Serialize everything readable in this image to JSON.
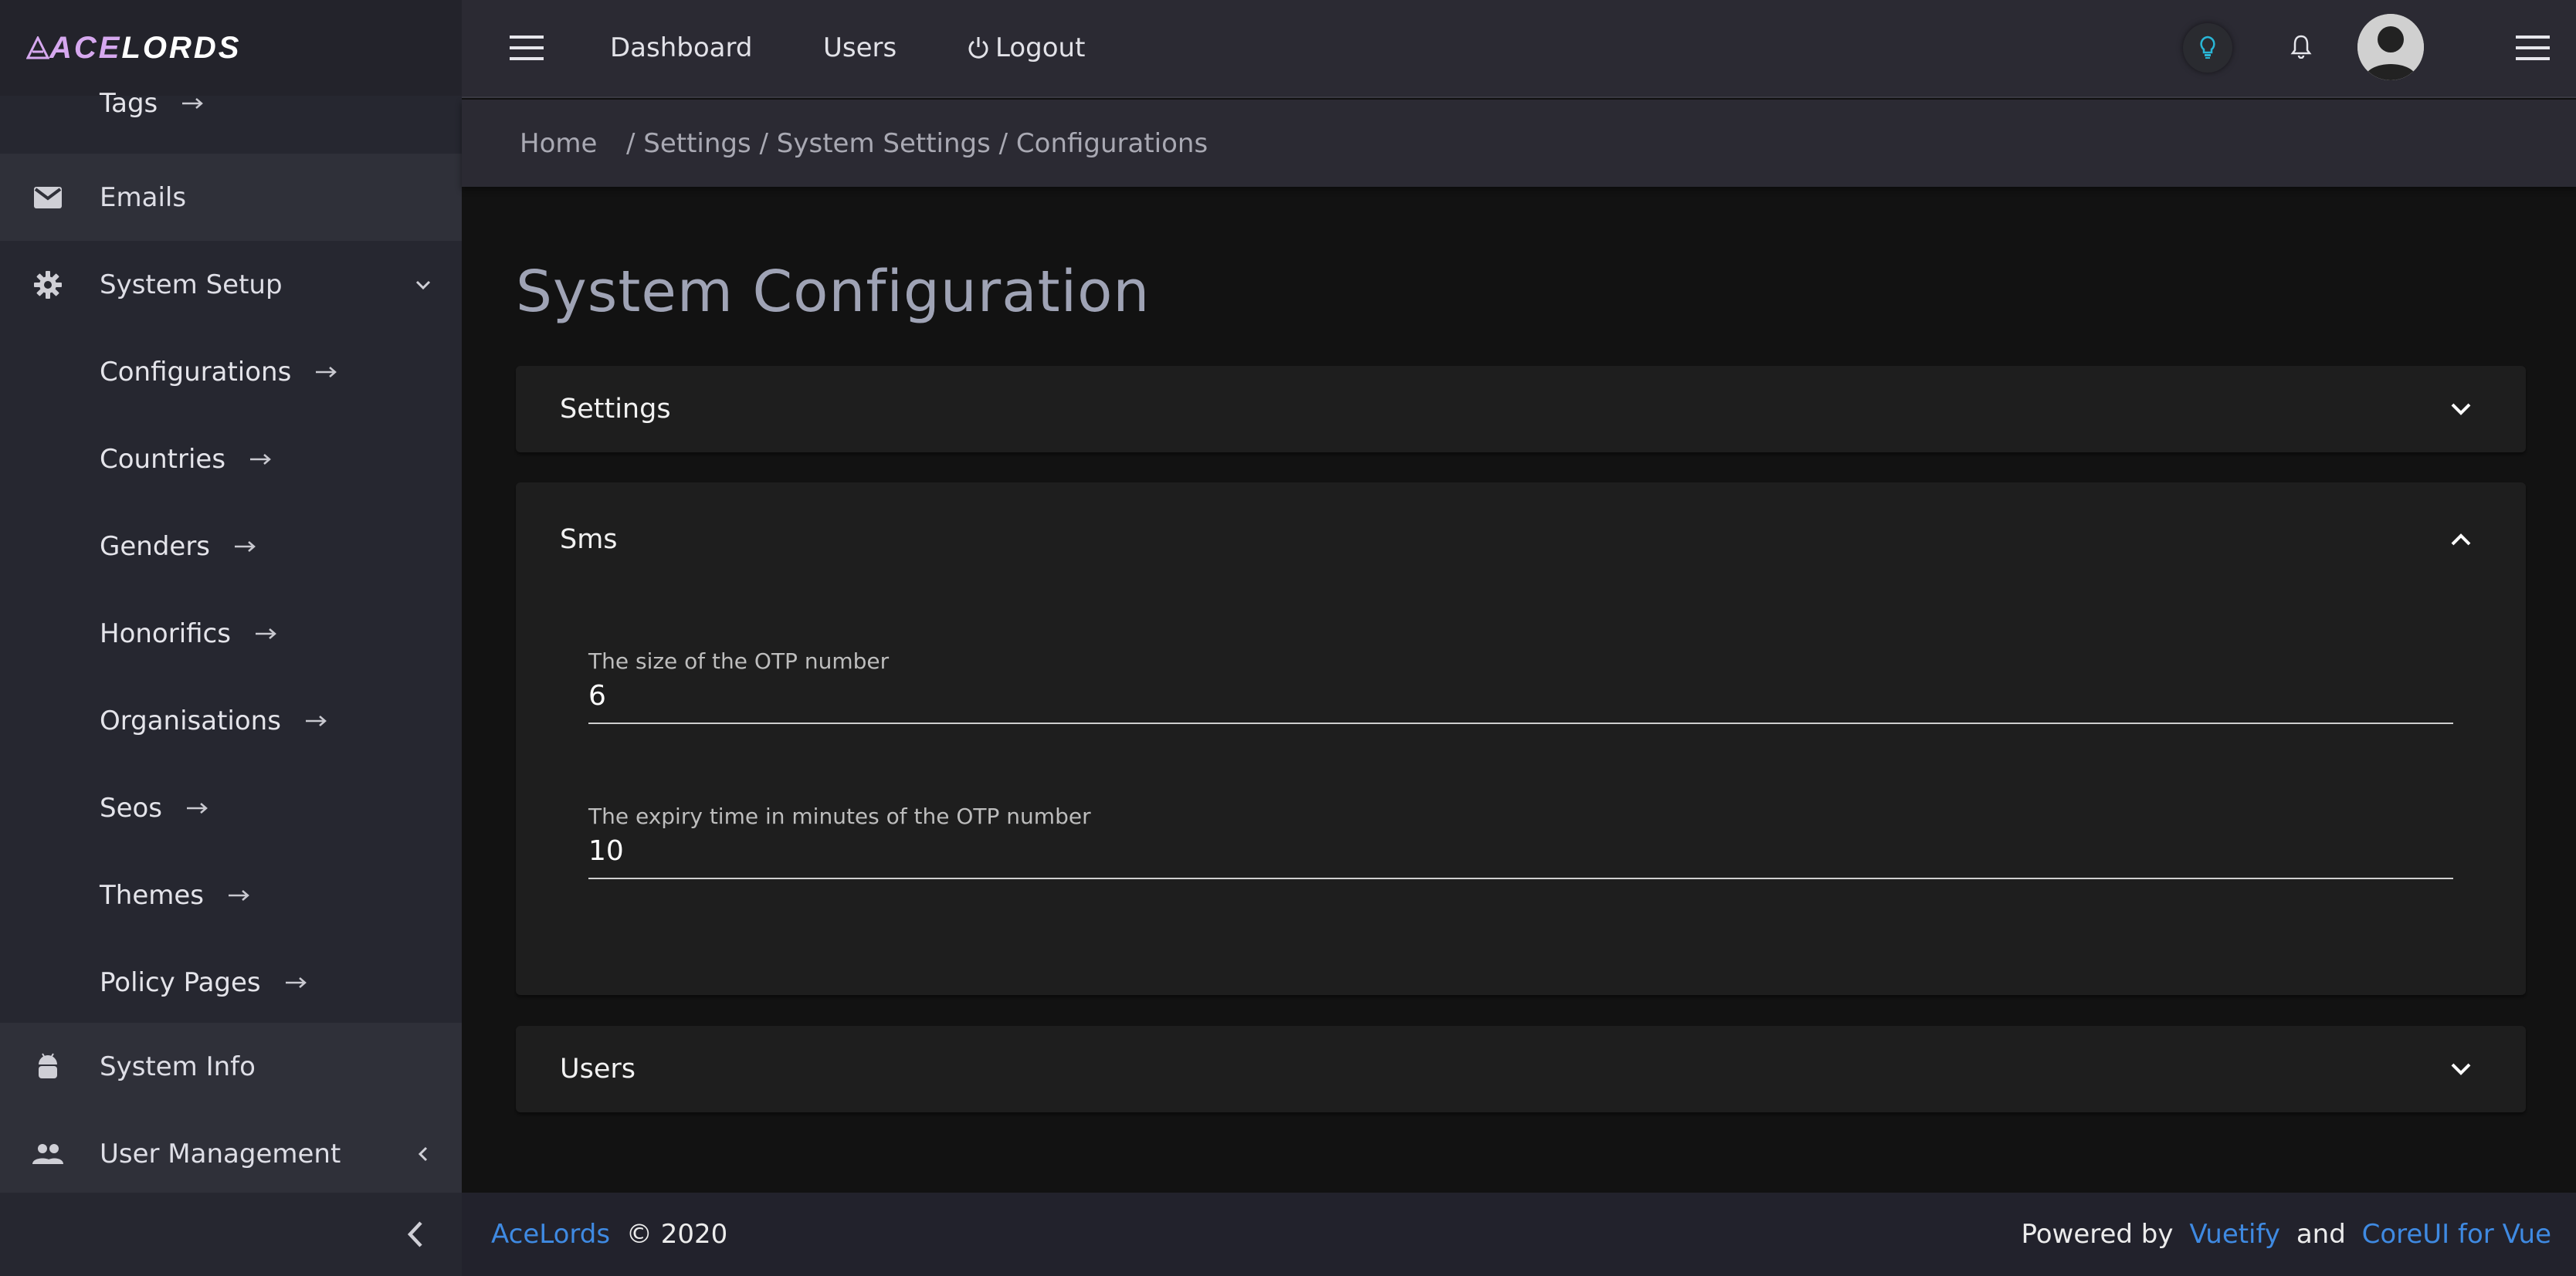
{
  "brand": {
    "part1": "ACE",
    "part2": "LORDS"
  },
  "sidebar": {
    "items": [
      {
        "label": "Tags"
      },
      {
        "label": "Emails"
      },
      {
        "label": "System Setup"
      },
      {
        "label": "Configurations"
      },
      {
        "label": "Countries"
      },
      {
        "label": "Genders"
      },
      {
        "label": "Honorifics"
      },
      {
        "label": "Organisations"
      },
      {
        "label": "Seos"
      },
      {
        "label": "Themes"
      },
      {
        "label": "Policy Pages"
      },
      {
        "label": "System Info"
      },
      {
        "label": "User Management"
      }
    ]
  },
  "header": {
    "nav": {
      "dashboard": "Dashboard",
      "users": "Users",
      "logout": "Logout"
    }
  },
  "breadcrumb": {
    "home": "Home",
    "rest": "/ Settings / System Settings / Configurations"
  },
  "main": {
    "title": "System Configuration",
    "panels": [
      {
        "title": "Settings",
        "expanded": false
      },
      {
        "title": "Sms",
        "expanded": true,
        "fields": [
          {
            "label": "The size of the OTP number",
            "value": "6"
          },
          {
            "label": "The expiry time in minutes of the OTP number",
            "value": "10"
          }
        ]
      },
      {
        "title": "Users",
        "expanded": false
      }
    ]
  },
  "footer": {
    "brand": "AceLords",
    "copyright": "© 2020",
    "powered_by": "Powered by",
    "link1": "Vuetify",
    "and": "and",
    "link2": "CoreUI for Vue"
  },
  "colors": {
    "sidebar_bg": "#262730",
    "header_bg": "#2b2a33",
    "content_bg": "#121212",
    "panel_bg": "#1e1e1e",
    "link": "#3f8ae2",
    "bulb": "#29b6d6"
  }
}
